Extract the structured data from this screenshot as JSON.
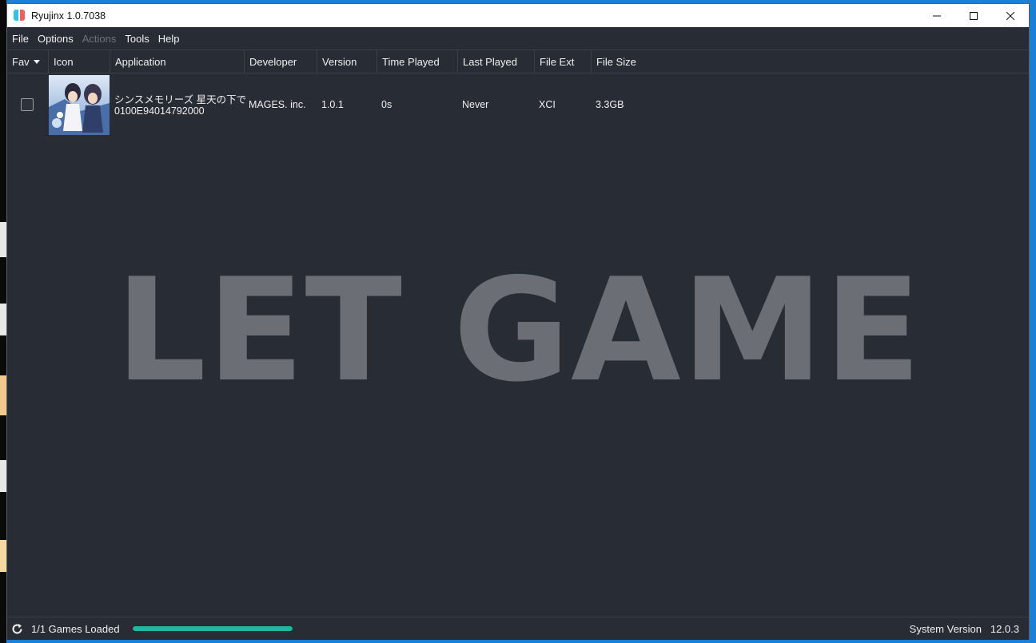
{
  "window": {
    "title": "Ryujinx 1.0.7038"
  },
  "menu": [
    {
      "label": "File",
      "enabled": true
    },
    {
      "label": "Options",
      "enabled": true
    },
    {
      "label": "Actions",
      "enabled": false
    },
    {
      "label": "Tools",
      "enabled": true
    },
    {
      "label": "Help",
      "enabled": true
    }
  ],
  "columns": [
    {
      "label": "Fav"
    },
    {
      "label": "Icon"
    },
    {
      "label": "Application"
    },
    {
      "label": "Developer"
    },
    {
      "label": "Version"
    },
    {
      "label": "Time Played"
    },
    {
      "label": "Last Played"
    },
    {
      "label": "File Ext"
    },
    {
      "label": "File Size"
    }
  ],
  "games": [
    {
      "favorite": false,
      "name": "シンスメモリーズ 星天の下で",
      "title_id": "0100E94014792000",
      "developer": "MAGES. inc.",
      "version": "1.0.1",
      "time_played": "0s",
      "last_played": "Never",
      "file_ext": "XCI",
      "file_size": "3.3GB"
    }
  ],
  "watermark": "LET GAME",
  "status": {
    "games_loaded": "1/1 Games Loaded",
    "progress": 1.0,
    "system_version_label": "System Version",
    "system_version": "12.0.3"
  },
  "colors": {
    "background": "#282c34",
    "accent": "#21b7a2"
  }
}
